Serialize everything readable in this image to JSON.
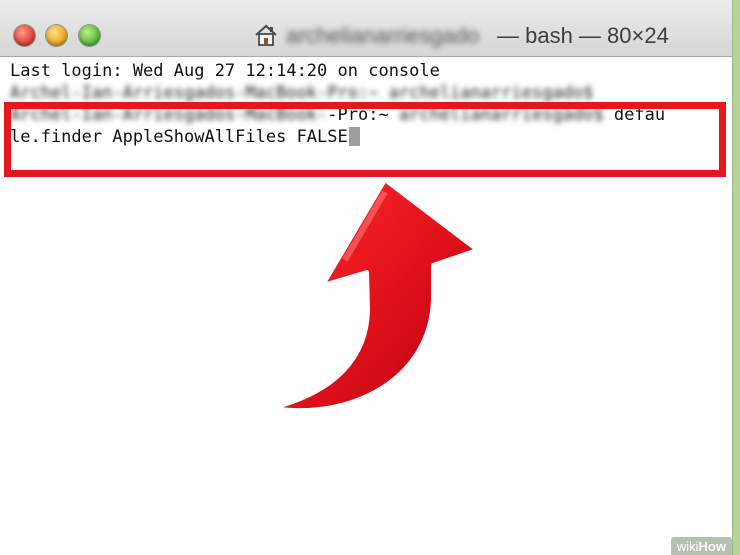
{
  "titlebar": {
    "title_user_blurred": "archelianarriesgado",
    "title_rest": "— bash — 80×24",
    "icon": "home-icon"
  },
  "terminal": {
    "line1": "Last login: Wed Aug 27 12:14:20 on console",
    "line2_blurred": "Archel-Ian-Arriesgados-MacBook-Pro:~ archelianarriesgado$",
    "line3_blurred": "Archel-Ian-Arriesgados-MacBook-",
    "line3_visible": "-Pro:~",
    "line3_tail_blurred": "archelianarriesgado$",
    "line3_end": "defau",
    "line4": "le.finder AppleShowAllFiles FALSE"
  },
  "annotation": {
    "highlight_color": "#e5161c",
    "arrow_icon": "curved-arrow-up-icon"
  },
  "watermark": {
    "prefix": "wiki",
    "brand": "How"
  }
}
